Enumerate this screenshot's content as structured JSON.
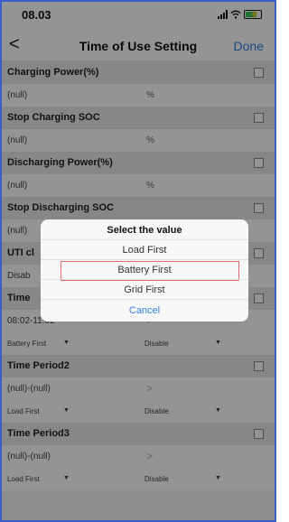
{
  "status_bar": {
    "time": "08.03"
  },
  "nav": {
    "back": "<",
    "title": "Time of Use Setting",
    "done": "Done"
  },
  "settings": {
    "charging_power": {
      "label": "Charging Power(%)",
      "value": "(null)",
      "unit": "%"
    },
    "stop_charging_soc": {
      "label": "Stop Charging SOC",
      "value": "(null)",
      "unit": "%"
    },
    "discharging_power": {
      "label": "Discharging Power(%)",
      "value": "(null)",
      "unit": "%"
    },
    "stop_discharging_soc": {
      "label": "Stop Discharging SOC",
      "value": "(null)"
    },
    "uti_row": {
      "label": "UTI cl",
      "value": "Disab"
    },
    "time_period1": {
      "label": "Time",
      "range": "08:02-11:02",
      "chevron": ">",
      "mode": "Battery First",
      "enable": "Disable"
    },
    "time_period2": {
      "label": "Time Period2",
      "range": "(null)-(null)",
      "chevron": ">",
      "mode": "Load First",
      "enable": "Disable"
    },
    "time_period3": {
      "label": "Time Period3",
      "range": "(null)-(null)",
      "chevron": ">",
      "mode": "Load First",
      "enable": "Disable"
    }
  },
  "picker": {
    "title": "Select the value",
    "options": [
      "Load First",
      "Battery First",
      "Grid First"
    ],
    "selected": "Battery First",
    "cancel": "Cancel"
  },
  "colors": {
    "accent": "#2f7fe0",
    "highlight_border": "#e46a6a",
    "battery": "#34c759"
  }
}
